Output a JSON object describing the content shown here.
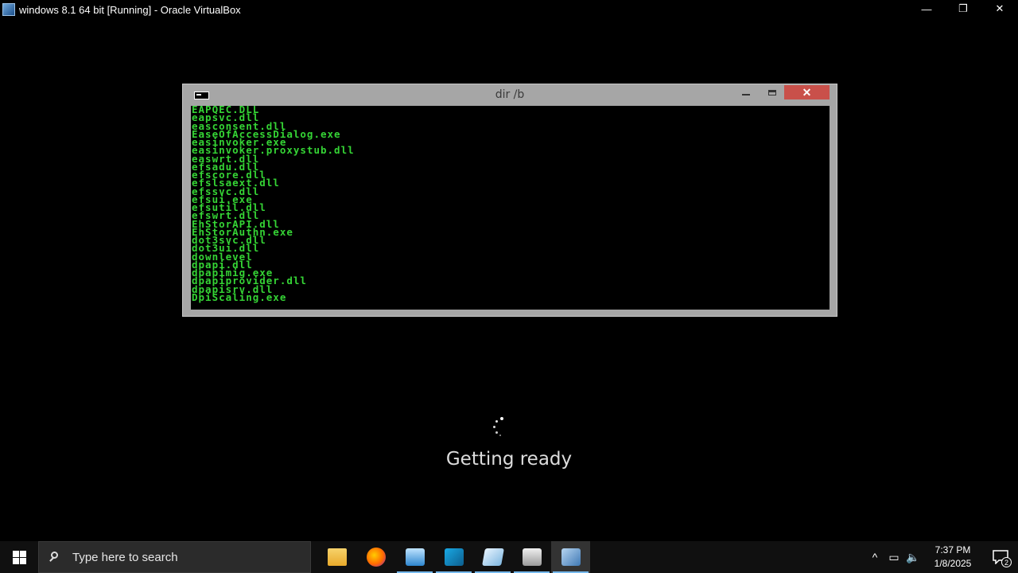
{
  "host_window": {
    "title": "windows 8.1 64 bit [Running] - Oracle VirtualBox",
    "icon": "virtualbox-icon",
    "controls": {
      "minimize": "—",
      "restore": "❐",
      "close": "✕"
    }
  },
  "console": {
    "title": "dir /b",
    "close_glyph": "✕",
    "lines": [
      "EAPQEC.DLL",
      "eapsvc.dll",
      "easconsent.dll",
      "EaseOfAccessDialog.exe",
      "easinvoker.exe",
      "easinvoker.proxystub.dll",
      "easwrt.dll",
      "efsadu.dll",
      "efscore.dll",
      "efslsaext.dll",
      "efssvc.dll",
      "efsui.exe",
      "efsutil.dll",
      "efswrt.dll",
      "EhStorAPI.dll",
      "EhStorAuthn.exe",
      "dot3svc.dll",
      "dot3ui.dll",
      "downlevel",
      "dpapi.dll",
      "dpapimig.exe",
      "dpapiprovider.dll",
      "dpapisrv.dll",
      "DpiScaling.exe"
    ]
  },
  "status": {
    "message": "Getting ready"
  },
  "taskbar": {
    "search_placeholder": "Type here to search",
    "apps": [
      {
        "name": "file-explorer",
        "icon": "folder-icon"
      },
      {
        "name": "firefox",
        "icon": "firefox-icon"
      },
      {
        "name": "remote-desktop",
        "icon": "remote-desktop-icon"
      },
      {
        "name": "visual-studio",
        "icon": "visual-studio-icon"
      },
      {
        "name": "notepad",
        "icon": "notepad-icon"
      },
      {
        "name": "printer",
        "icon": "printer-icon"
      },
      {
        "name": "virtualbox",
        "icon": "virtualbox-icon",
        "active": true
      }
    ],
    "tray": {
      "chevron": "^",
      "network": "▭",
      "volume": "🔈"
    },
    "clock": {
      "time": "7:37 PM",
      "date": "1/8/2025"
    },
    "notifications": {
      "count": "2"
    }
  },
  "colors": {
    "console_text": "#35d435",
    "accent": "#76b9ed",
    "close_red": "#c9504a"
  }
}
